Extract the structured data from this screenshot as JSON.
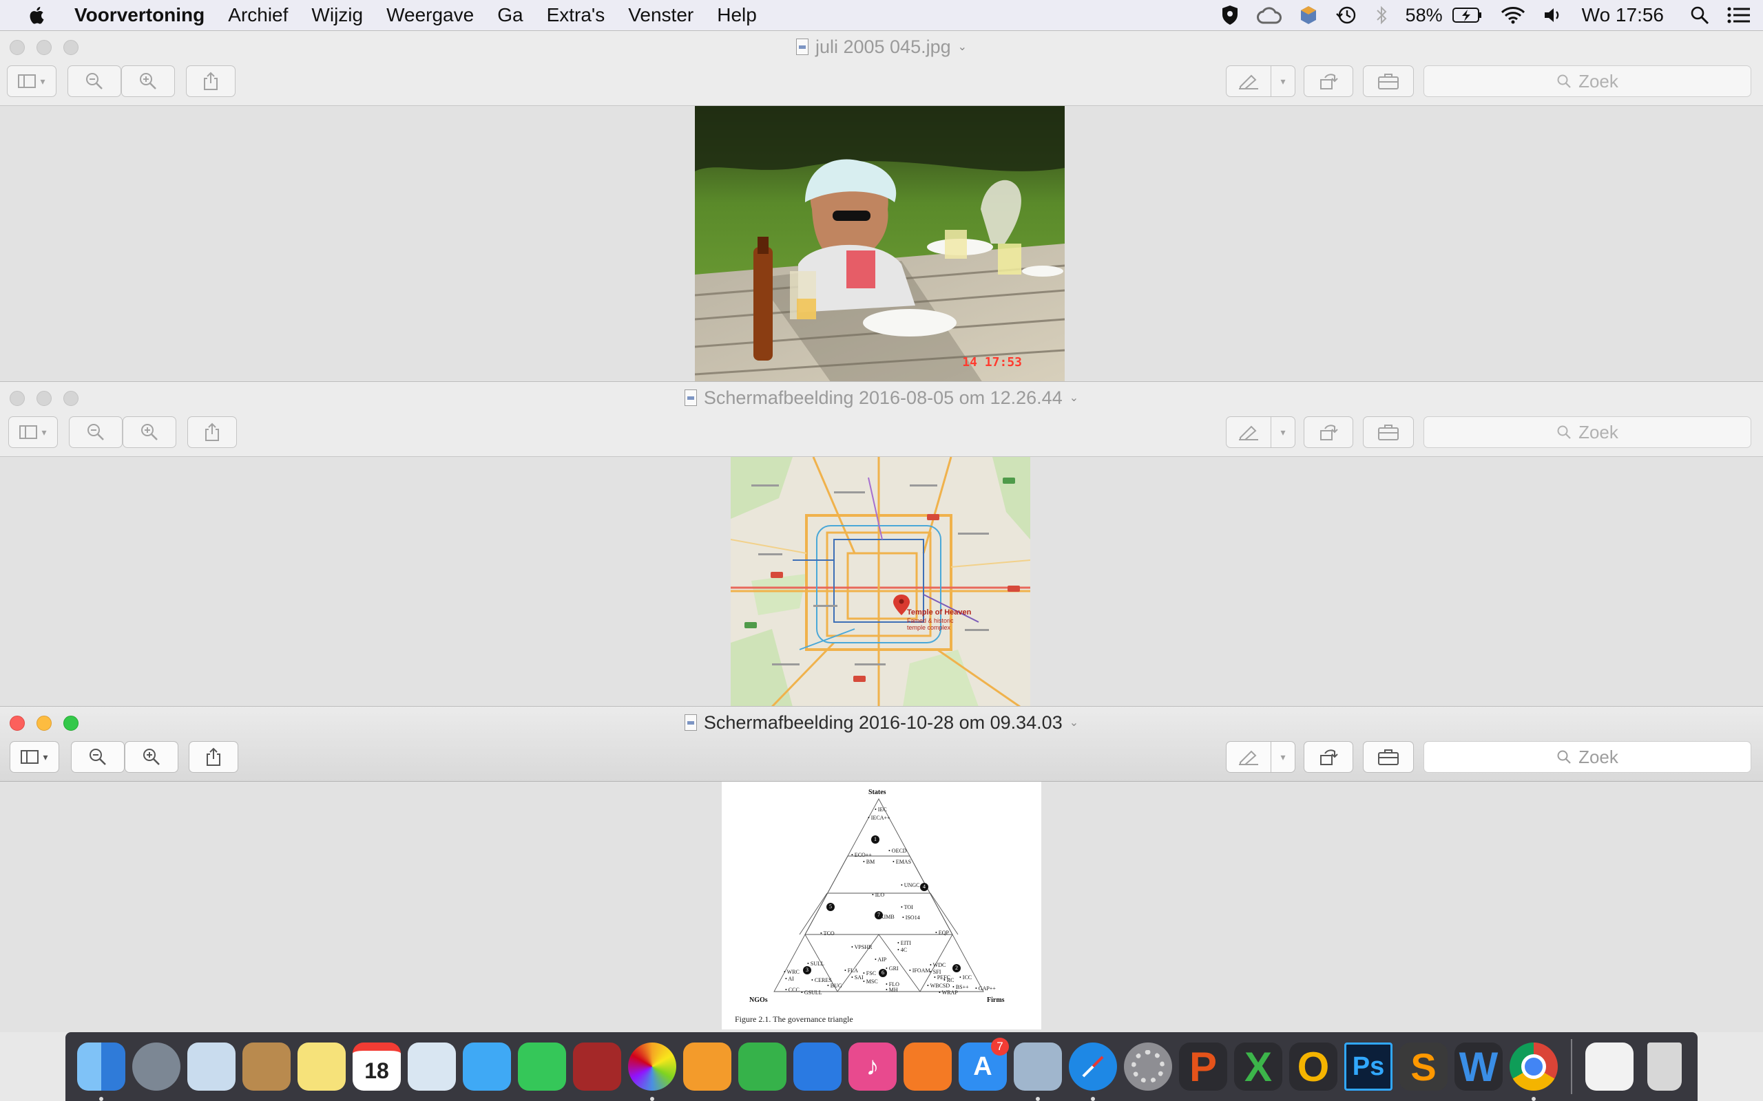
{
  "menubar": {
    "app_name": "Voorvertoning",
    "items": [
      "Archief",
      "Wijzig",
      "Weergave",
      "Ga",
      "Extra's",
      "Venster",
      "Help"
    ],
    "battery": "58%",
    "clock": "Wo 17:56"
  },
  "windows": [
    {
      "title": "juli 2005 045.jpg",
      "search_placeholder": "Zoek",
      "active": false,
      "photo_timestamp": "14  17:53"
    },
    {
      "title": "Schermafbeelding 2016-08-05 om 12.26.44",
      "search_placeholder": "Zoek",
      "active": false,
      "map_label": "Temple of Heaven",
      "map_sublabel": "Famed & historic temple complex"
    },
    {
      "title": "Schermafbeelding 2016-10-28 om 09.34.03",
      "search_placeholder": "Zoek",
      "active": true,
      "figure": {
        "top_label": "States",
        "left_label": "NGOs",
        "right_label": "Firms",
        "caption": "Figure 2.1. The governance triangle",
        "zone_numbers": [
          "1",
          "2",
          "3",
          "4",
          "5",
          "6",
          "7"
        ],
        "points": [
          "IEC",
          "IECA++",
          "OECD",
          "EMAS",
          "ECO++",
          "BM",
          "UNGC",
          "TOI",
          "ISO14",
          "EQP",
          "ILO",
          "KIMB",
          "TCO",
          "EITI",
          "4C",
          "VPSHR",
          "AIP",
          "SULL",
          "WRC",
          "AI",
          "CERES",
          "CCC",
          "BUG",
          "GSULL",
          "FLA",
          "SAI",
          "FSC",
          "MSC",
          "GRI",
          "FLO",
          "MH",
          "IFOAM",
          "WDC",
          "SFI",
          "PEFC",
          "ICC",
          "WBCSD",
          "BS++",
          "GAP++",
          "WRAP",
          "RC"
        ]
      }
    }
  ],
  "dock": {
    "apps": [
      {
        "name": "Finder",
        "letter": "",
        "color": "#3b8ff0",
        "running": true
      },
      {
        "name": "Launchpad",
        "letter": "",
        "color": "#7c8794",
        "running": false
      },
      {
        "name": "Mail",
        "letter": "",
        "color": "#c9dcee",
        "running": false
      },
      {
        "name": "Contacten",
        "letter": "",
        "color": "#b98a4e",
        "running": false
      },
      {
        "name": "Notities",
        "letter": "",
        "color": "#f6e27a",
        "running": false
      },
      {
        "name": "Agenda",
        "letter": "18",
        "color": "#ffffff",
        "running": false
      },
      {
        "name": "Voorvertoning",
        "letter": "",
        "color": "#d9e6f2",
        "running": false
      },
      {
        "name": "Berichten",
        "letter": "",
        "color": "#3fa9f5",
        "running": false
      },
      {
        "name": "FaceTime",
        "letter": "",
        "color": "#35c759",
        "running": false
      },
      {
        "name": "Photo Booth",
        "letter": "",
        "color": "#a42828",
        "running": false
      },
      {
        "name": "Foto's",
        "letter": "",
        "color": "#f4f4f4",
        "running": true
      },
      {
        "name": "Pages",
        "letter": "",
        "color": "#f39b2b",
        "running": false
      },
      {
        "name": "Numbers",
        "letter": "",
        "color": "#36b24a",
        "running": false
      },
      {
        "name": "Keynote",
        "letter": "",
        "color": "#2a7ae2",
        "running": false
      },
      {
        "name": "iTunes",
        "letter": "♪",
        "color": "#e84a8e",
        "running": false
      },
      {
        "name": "iBooks",
        "letter": "",
        "color": "#f47a24",
        "running": false
      },
      {
        "name": "App Store",
        "letter": "A",
        "color": "#2f8ef2",
        "running": false,
        "badge": "7"
      },
      {
        "name": "Voorvertoning",
        "letter": "",
        "color": "#a0b6cd",
        "running": true
      },
      {
        "name": "Safari",
        "letter": "",
        "color": "#1e88e5",
        "running": true
      },
      {
        "name": "Systeemvoorkeuren",
        "letter": "",
        "color": "#8e8e93",
        "running": false
      },
      {
        "name": "PowerPoint",
        "letter": "P",
        "color": "#2b2b30",
        "running": false
      },
      {
        "name": "Excel",
        "letter": "X",
        "color": "#2b2b30",
        "running": false
      },
      {
        "name": "Outlook",
        "letter": "O",
        "color": "#2b2b30",
        "running": false
      },
      {
        "name": "Photoshop",
        "letter": "Ps",
        "color": "#0b1f3a",
        "running": false
      },
      {
        "name": "Sublime Text",
        "letter": "S",
        "color": "#3a3a3a",
        "running": false
      },
      {
        "name": "Word",
        "letter": "W",
        "color": "#2b2b30",
        "running": false
      },
      {
        "name": "Chrome",
        "letter": "",
        "color": "#e9e9e9",
        "running": true
      }
    ],
    "trailing": [
      {
        "name": "Documenten",
        "color": "#f2f2f2"
      },
      {
        "name": "Prullenmand",
        "color": "#d7d7d7"
      }
    ]
  }
}
